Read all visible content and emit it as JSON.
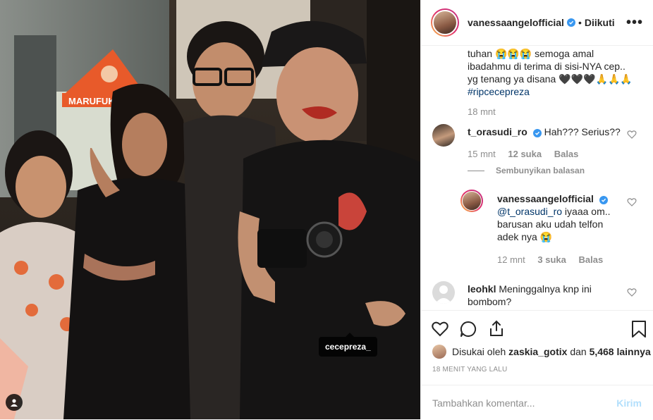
{
  "post": {
    "photo_tag": "cecepreza_",
    "store_sign": "MARUFUK"
  },
  "header": {
    "username": "vanessaangelofficial",
    "separator": "•",
    "follow_status": "Diikuti",
    "more_icon": "more-icon"
  },
  "caption": {
    "line1": "tuhan",
    "emoji_cry": "😭😭😭",
    "line2": " semoga amal ibadahmu di terima di sisi-NYA cep.. yg tenang ya disana ",
    "emoji_hearts": "🖤🖤🖤🙏🙏🙏",
    "hashtag": "#ripcecepreza",
    "time": "18 mnt"
  },
  "comments": [
    {
      "username": "t_orasudi_ro",
      "text": "Hah??? Serius??",
      "time": "15 mnt",
      "likes": "12 suka",
      "reply": "Balas"
    },
    {
      "username": "vanessaangelofficial",
      "mention": "@t_orasudi_ro",
      "text": " iyaaa om.. barusan aku udah telfon adek nya ",
      "emoji": "😭",
      "time": "12 mnt",
      "likes": "3 suka",
      "reply": "Balas"
    },
    {
      "username": "leohkl",
      "text": "Meninggalnya knp ini bombom?"
    }
  ],
  "hide_replies": "Sembunyikan balasan",
  "actions": {
    "liked_by_prefix": "Disukai oleh",
    "liked_by_user": "zaskia_gotix",
    "liked_by_and": "dan",
    "liked_count": "5,468 lainnya",
    "time_ago": "18 MENIT YANG LALU"
  },
  "comment_box": {
    "placeholder": "Tambahkan komentar...",
    "post_label": "Kirim"
  },
  "colors": {
    "verified": "#3897f0",
    "link": "#003569",
    "muted": "#8e8e8e",
    "post_disabled": "#b2dffc"
  }
}
